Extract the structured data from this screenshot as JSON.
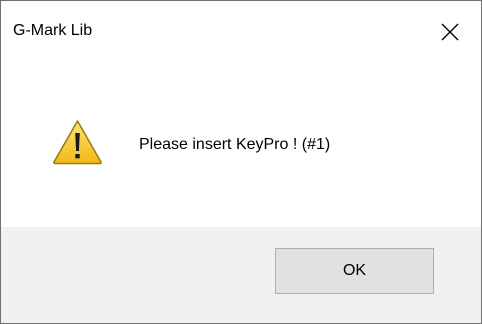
{
  "window": {
    "title": "G-Mark Lib"
  },
  "icons": {
    "close": "close-icon",
    "warning": "warning-icon"
  },
  "message": {
    "text": "Please insert KeyPro ! (#1)"
  },
  "buttons": {
    "ok_label": "OK"
  },
  "colors": {
    "warning_fill": "#f6c531",
    "warning_outline": "#9a7a10",
    "footer_background": "#f0f0f0",
    "button_face": "#e1e1e1"
  }
}
